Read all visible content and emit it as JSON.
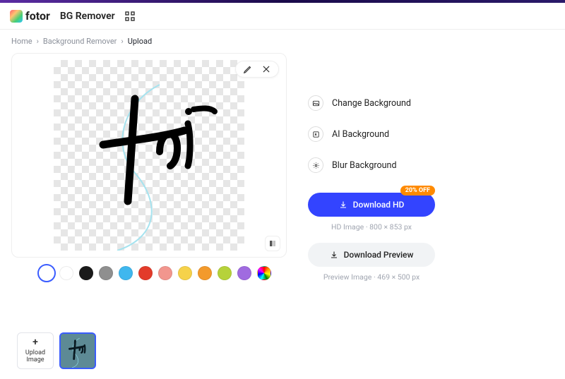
{
  "brand": {
    "name": "fotor"
  },
  "app_title": "BG Remover",
  "breadcrumb": {
    "home": "Home",
    "section": "Background Remover",
    "current": "Upload"
  },
  "options": {
    "change_bg": "Change Background",
    "ai_bg": "AI Background",
    "blur_bg": "Blur Background"
  },
  "download": {
    "badge": "20% OFF",
    "hd_label": "Download HD",
    "hd_meta": "HD Image · 800 × 853 px",
    "preview_label": "Download Preview",
    "preview_meta": "Preview Image · 469 × 500 px"
  },
  "swatches": [
    {
      "name": "transparent",
      "color": "#ffffff",
      "selected": true,
      "transparent": true
    },
    {
      "name": "white",
      "color": "#ffffff"
    },
    {
      "name": "black",
      "color": "#1a1a1a"
    },
    {
      "name": "gray",
      "color": "#8f8f8f"
    },
    {
      "name": "sky",
      "color": "#3fb7ee"
    },
    {
      "name": "red",
      "color": "#e33b2a"
    },
    {
      "name": "salmon",
      "color": "#f2968e"
    },
    {
      "name": "yellow",
      "color": "#f6d24a"
    },
    {
      "name": "orange",
      "color": "#f39a2c"
    },
    {
      "name": "lime",
      "color": "#b6d23a"
    },
    {
      "name": "purple",
      "color": "#a06be0"
    },
    {
      "name": "rainbow",
      "rainbow": true
    }
  ],
  "upload_tile": {
    "line1": "Upload",
    "line2": "Image"
  }
}
